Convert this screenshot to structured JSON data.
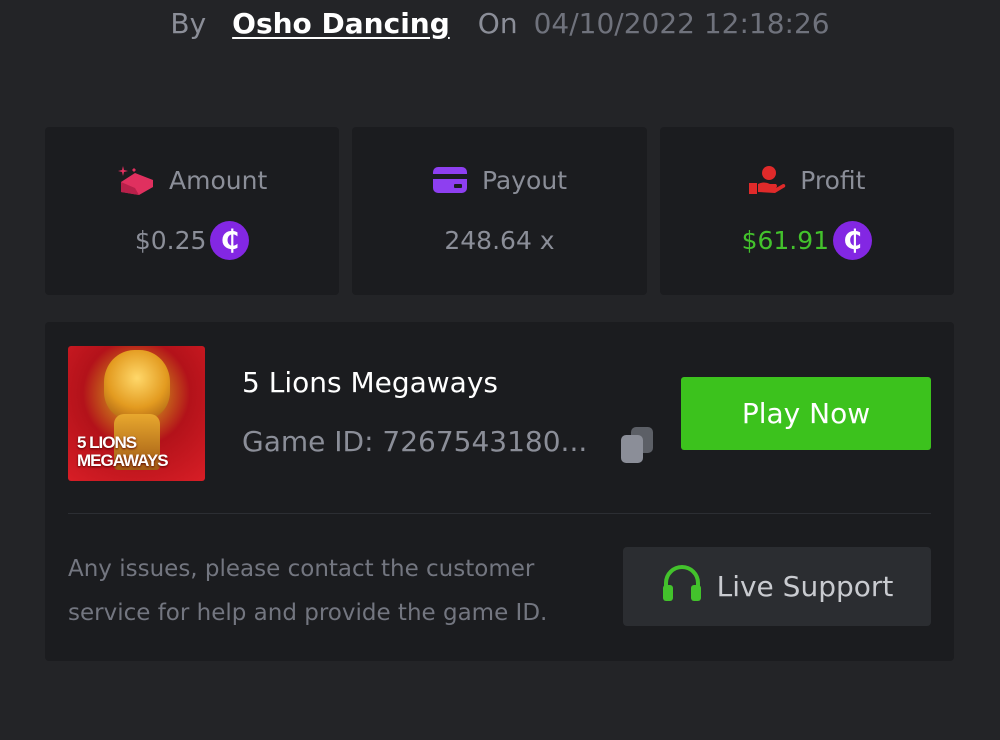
{
  "byline": {
    "by": "By",
    "user": "Osho Dancing",
    "on": "On",
    "datetime": "04/10/2022 12:18:26"
  },
  "stats": {
    "amount": {
      "label": "Amount",
      "value": "$0.25",
      "icon": "money-stack-icon",
      "icon_color": "#e0305f"
    },
    "payout": {
      "label": "Payout",
      "value": "248.64 x",
      "icon": "credit-card-icon",
      "icon_color": "#8e3ff0"
    },
    "profit": {
      "label": "Profit",
      "value": "$61.91",
      "icon": "hand-money-icon",
      "icon_color": "#e02a2a",
      "value_color": "#43c22c"
    },
    "coin_symbol": "₵"
  },
  "game": {
    "title": "5 Lions Megaways",
    "id_text": "Game ID: 7267543180...",
    "thumb_text_line1": "5 LIONS",
    "thumb_text_line2": "MEGAWAYS",
    "play_label": "Play Now"
  },
  "support": {
    "help_text": "Any issues, please contact the customer service for help and provide the game ID.",
    "button_label": "Live Support"
  },
  "colors": {
    "background": "#232427",
    "card": "#1b1c1f",
    "accent_green": "#3cc21d",
    "coin_purple": "#8327e3"
  }
}
